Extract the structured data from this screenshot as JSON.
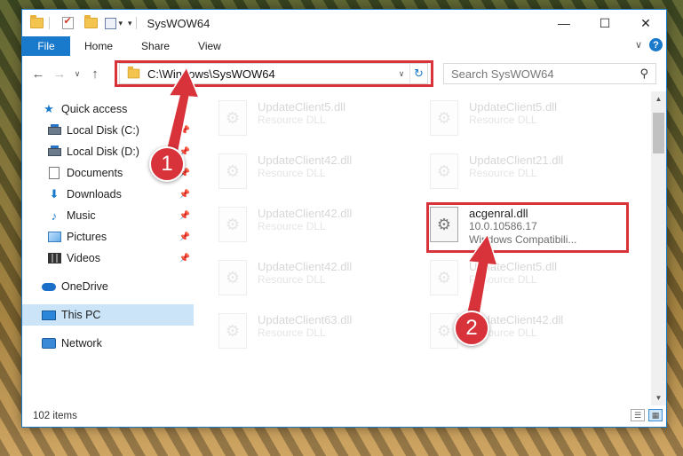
{
  "window": {
    "title": "SysWOW64",
    "buttons": {
      "minimize": "—",
      "maximize": "☐",
      "close": "✕"
    },
    "accent": "#1979ca"
  },
  "ribbon": {
    "file": "File",
    "tabs": [
      "Home",
      "Share",
      "View"
    ],
    "help": "?"
  },
  "nav": {
    "address": "C:\\Windows\\SysWOW64",
    "search_placeholder": "Search SysWOW64"
  },
  "sidebar": {
    "quick_access": "Quick access",
    "items": [
      {
        "label": "Local Disk (C:)",
        "icon": "drive-icon"
      },
      {
        "label": "Local Disk (D:)",
        "icon": "drive-icon"
      },
      {
        "label": "Documents",
        "icon": "documents-icon"
      },
      {
        "label": "Downloads",
        "icon": "downloads-icon"
      },
      {
        "label": "Music",
        "icon": "music-icon"
      },
      {
        "label": "Pictures",
        "icon": "pictures-icon"
      },
      {
        "label": "Videos",
        "icon": "videos-icon"
      }
    ],
    "onedrive": "OneDrive",
    "thispc": "This PC",
    "network": "Network"
  },
  "files": {
    "left": [
      {
        "name": "UpdateClient5.dll",
        "sub": "Resource DLL"
      },
      {
        "name": "UpdateClient42.dll",
        "sub": "Resource DLL"
      },
      {
        "name": "UpdateClient42.dll",
        "sub": "Resource DLL"
      },
      {
        "name": "UpdateClient42.dll",
        "sub": "Resource DLL"
      },
      {
        "name": "UpdateClient63.dll",
        "sub": "Resource DLL"
      }
    ],
    "right": [
      {
        "name": "UpdateClient5.dll",
        "sub": "Resource DLL"
      },
      {
        "name": "UpdateClient21.dll",
        "sub": "Resource DLL"
      },
      {
        "name": "acgenral.dll",
        "sub": "10.0.10586.17",
        "sub2": "Windows Compatibili..."
      },
      {
        "name": "UpdateClient5.dll",
        "sub": "Resource DLL"
      },
      {
        "name": "UpdateClient42.dll",
        "sub": "Resource DLL"
      }
    ]
  },
  "status": {
    "items": "102 items"
  },
  "callouts": {
    "one": "1",
    "two": "2"
  },
  "highlight_color": "#d8323a"
}
